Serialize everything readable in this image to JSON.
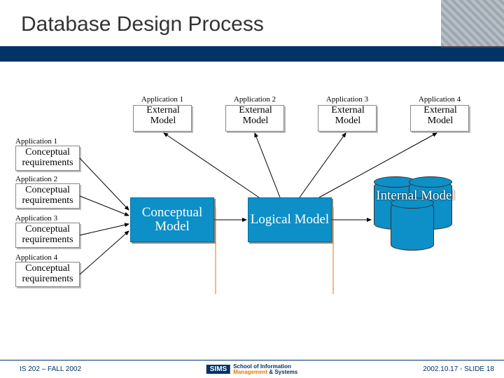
{
  "title": "Database Design Process",
  "external": [
    {
      "app": "Application 1",
      "line1": "External",
      "line2": "Model"
    },
    {
      "app": "Application 2",
      "line1": "External",
      "line2": "Model"
    },
    {
      "app": "Application 3",
      "line1": "External",
      "line2": "Model"
    },
    {
      "app": "Application 4",
      "line1": "External",
      "line2": "Model"
    }
  ],
  "requirements": [
    {
      "app": "Application 1",
      "line1": "Conceptual",
      "line2": "requirements"
    },
    {
      "app": "Application 2",
      "line1": "Conceptual",
      "line2": "requirements"
    },
    {
      "app": "Application 3",
      "line1": "Conceptual",
      "line2": "requirements"
    },
    {
      "app": "Application 4",
      "line1": "Conceptual",
      "line2": "requirements"
    }
  ],
  "conceptual_model": "Conceptual Model",
  "logical_model": "Logical Model",
  "internal_model": "Internal Model",
  "footer": {
    "left": "IS 202 – FALL 2002",
    "logo": "SIMS",
    "logo_sub1": "School of Information",
    "logo_sub2_a": "Management",
    "logo_sub2_b": "& Systems",
    "right": "2002.10.17 - SLIDE 18"
  },
  "chart_data": {
    "type": "diagram",
    "title": "Database Design Process",
    "nodes": [
      {
        "id": "req1",
        "label": "Application 1 Conceptual requirements"
      },
      {
        "id": "req2",
        "label": "Application 2 Conceptual requirements"
      },
      {
        "id": "req3",
        "label": "Application 3 Conceptual requirements"
      },
      {
        "id": "req4",
        "label": "Application 4 Conceptual requirements"
      },
      {
        "id": "cm",
        "label": "Conceptual Model"
      },
      {
        "id": "lm",
        "label": "Logical Model"
      },
      {
        "id": "im",
        "label": "Internal Model"
      },
      {
        "id": "ext1",
        "label": "Application 1 External Model"
      },
      {
        "id": "ext2",
        "label": "Application 2 External Model"
      },
      {
        "id": "ext3",
        "label": "Application 3 External Model"
      },
      {
        "id": "ext4",
        "label": "Application 4 External Model"
      }
    ],
    "edges": [
      {
        "from": "req1",
        "to": "cm"
      },
      {
        "from": "req2",
        "to": "cm"
      },
      {
        "from": "req3",
        "to": "cm"
      },
      {
        "from": "req4",
        "to": "cm"
      },
      {
        "from": "cm",
        "to": "lm"
      },
      {
        "from": "lm",
        "to": "im"
      },
      {
        "from": "lm",
        "to": "ext1"
      },
      {
        "from": "lm",
        "to": "ext2"
      },
      {
        "from": "lm",
        "to": "ext3"
      },
      {
        "from": "lm",
        "to": "ext4"
      }
    ]
  }
}
